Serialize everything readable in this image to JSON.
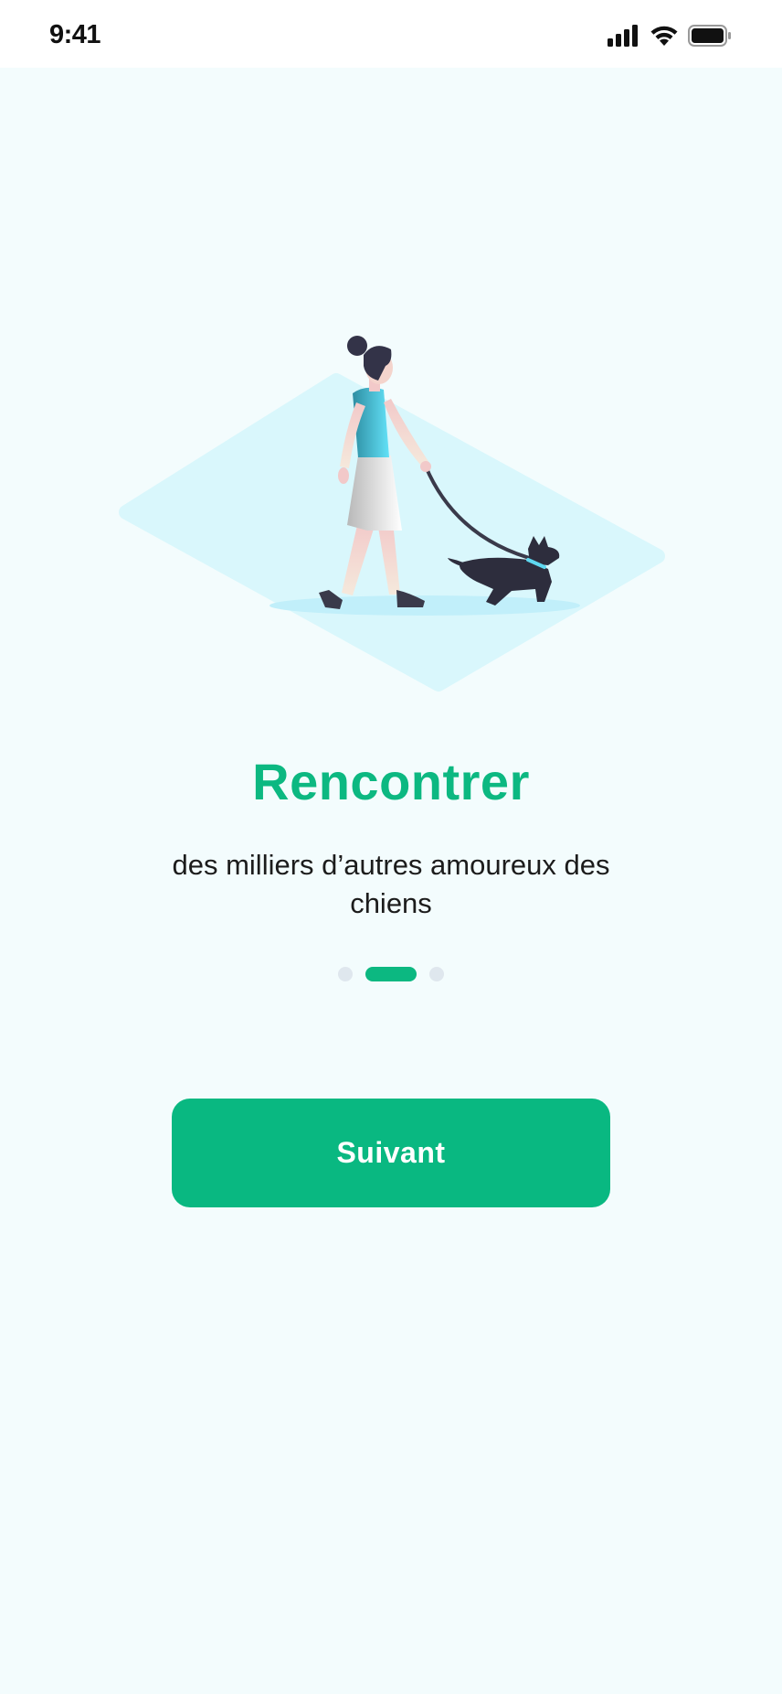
{
  "status_bar": {
    "time": "9:41",
    "icons": [
      "signal-icon",
      "wifi-icon",
      "battery-icon"
    ]
  },
  "onboarding": {
    "illustration": "woman-walking-dog-illustration",
    "title": "Rencontrer",
    "subtitle": "des milliers d’autres amoureux des chiens",
    "pager": {
      "total": 3,
      "active_index": 1
    },
    "next_button_label": "Suivant"
  },
  "colors": {
    "accent": "#0cb881",
    "background": "#f3fcfd",
    "text": "#1c1c1c",
    "inactive_dot": "#dfe7ee"
  }
}
